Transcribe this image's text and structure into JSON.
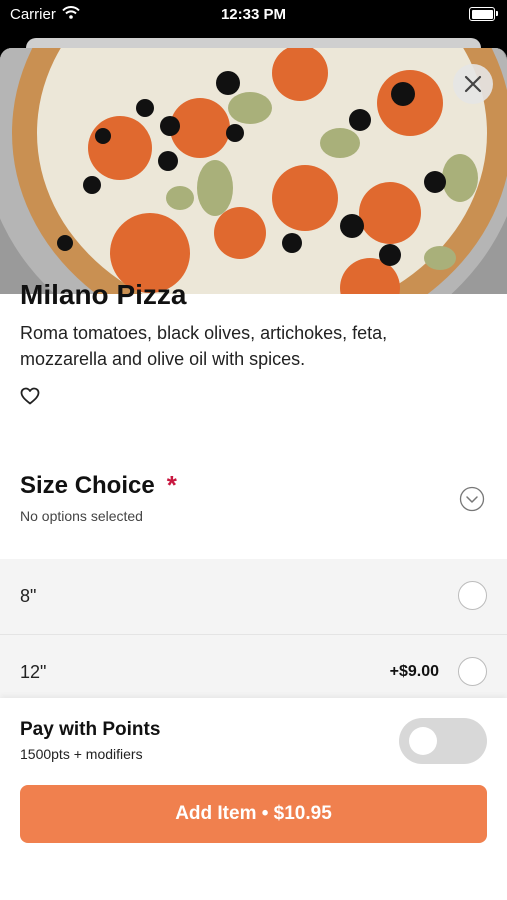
{
  "status": {
    "carrier": "Carrier",
    "time": "12:33 PM"
  },
  "item": {
    "title": "Milano Pizza",
    "description": "Roma tomatoes, black olives, artichokes, feta, mozzarella and olive oil with spices."
  },
  "size_section": {
    "title": "Size Choice",
    "required_mark": "*",
    "subtitle": "No options selected",
    "options": [
      {
        "label": "8\"",
        "price": ""
      },
      {
        "label": "12\"",
        "price": "+$9.00"
      }
    ]
  },
  "points": {
    "title": "Pay with Points",
    "subtitle": "1500pts + modifiers",
    "enabled": false
  },
  "cta": {
    "label": "Add Item • $10.95"
  },
  "colors": {
    "accent": "#f0804e",
    "required": "#c8173f"
  }
}
